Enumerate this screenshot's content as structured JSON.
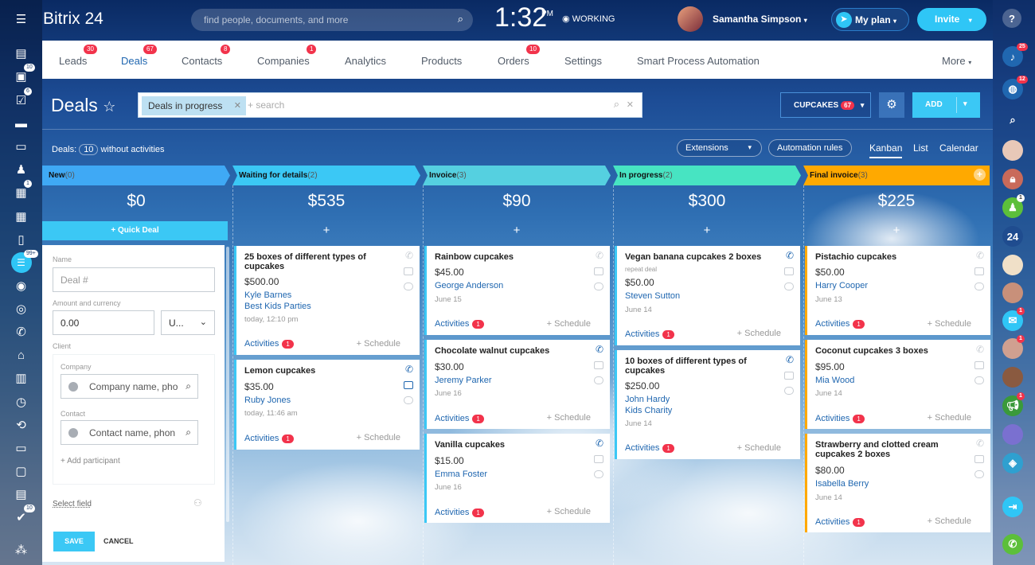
{
  "app": {
    "name": "Bitrix 24"
  },
  "search": {
    "placeholder": "find people, documents, and more"
  },
  "clock": {
    "time": "1:32",
    "ampm": "PM",
    "status": "WORKING"
  },
  "user": {
    "name": "Samantha Simpson"
  },
  "buttons": {
    "my_plan": "My plan",
    "invite": "Invite"
  },
  "nav": [
    {
      "label": "Leads",
      "badge": "30"
    },
    {
      "label": "Deals",
      "badge": "67"
    },
    {
      "label": "Contacts",
      "badge": "8"
    },
    {
      "label": "Companies",
      "badge": "1"
    },
    {
      "label": "Analytics"
    },
    {
      "label": "Products"
    },
    {
      "label": "Orders",
      "badge": "10"
    },
    {
      "label": "Settings"
    },
    {
      "label": "Smart Process Automation"
    },
    {
      "label": "More"
    }
  ],
  "page": {
    "title": "Deals"
  },
  "filter": {
    "tag": "Deals in progress",
    "search_placeholder": "+ search"
  },
  "toolbar": {
    "category": "CUPCAKES",
    "category_count": "67",
    "add": "ADD"
  },
  "info": {
    "prefix": "Deals:",
    "count": "10",
    "suffix": "without activities"
  },
  "controls": {
    "extensions": "Extensions",
    "automation": "Automation rules"
  },
  "views": {
    "kanban": "Kanban",
    "list": "List",
    "calendar": "Calendar"
  },
  "colors": {
    "accent": "#3bc8f5",
    "link": "#2067b0",
    "badge": "#f2334b"
  },
  "columns": [
    {
      "name": "New",
      "count": "(0)",
      "sum": "$0",
      "color": "#3fa9f5"
    },
    {
      "name": "Waiting for details",
      "count": "(2)",
      "sum": "$535",
      "color": "#3bc8f5"
    },
    {
      "name": "Invoice",
      "count": "(3)",
      "sum": "$90",
      "color": "#55d0e0"
    },
    {
      "name": "In progress",
      "count": "(2)",
      "sum": "$300",
      "color": "#47e4c2"
    },
    {
      "name": "Final invoice",
      "count": "(3)",
      "sum": "$225",
      "color": "#ffa900"
    }
  ],
  "quick_deal": "+ Quick Deal",
  "plus": "+",
  "form": {
    "name_label": "Name",
    "name_placeholder": "Deal #",
    "amount_label": "Amount and currency",
    "amount_value": "0.00",
    "currency_value": "U...",
    "client_label": "Client",
    "company_label": "Company",
    "company_placeholder": "Company name, pho",
    "contact_label": "Contact",
    "contact_placeholder": "Contact name, phon",
    "add_participant": "+ Add participant",
    "select_field": "Select field",
    "save": "SAVE",
    "cancel": "CANCEL"
  },
  "card_common": {
    "activities": "Activities",
    "schedule": "+ Schedule",
    "activity_count": "1"
  },
  "cards": {
    "c1": {
      "title": "25 boxes of different types of cupcakes",
      "price": "$500.00",
      "link1": "Kyle Barnes",
      "link2": "Best Kids Parties",
      "date": "today, 12:10 pm"
    },
    "c2": {
      "title": "Lemon cupcakes",
      "price": "$35.00",
      "link1": "Ruby Jones",
      "date": "today, 11:46 am"
    },
    "c3": {
      "title": "Rainbow cupcakes",
      "price": "$45.00",
      "link1": "George Anderson",
      "date": "June 15"
    },
    "c4": {
      "title": "Chocolate walnut cupcakes",
      "price": "$30.00",
      "link1": "Jeremy Parker",
      "date": "June 16"
    },
    "c5": {
      "title": "Vanilla cupcakes",
      "price": "$15.00",
      "link1": "Emma Foster",
      "date": "June 16"
    },
    "c6": {
      "title": "Vegan banana cupcakes 2 boxes",
      "note": "repeat deal",
      "price": "$50.00",
      "link1": "Steven Sutton",
      "date": "June 14"
    },
    "c7": {
      "title": "10 boxes of different types of cupcakes",
      "price": "$250.00",
      "link1": "John Hardy",
      "link2": "Kids Charity",
      "date": "June 14"
    },
    "c8": {
      "title": "Pistachio cupcakes",
      "price": "$50.00",
      "link1": "Harry Cooper",
      "date": "June 13"
    },
    "c9": {
      "title": "Coconut cupcakes 3 boxes",
      "price": "$95.00",
      "link1": "Mia Wood",
      "date": "June 14"
    },
    "c10": {
      "title": "Strawberry and clotted cream cupcakes 2 boxes",
      "price": "$80.00",
      "link1": "Isabella Berry",
      "date": "June 14"
    }
  },
  "left_badges": {
    "b1": "10",
    "b2": "6",
    "b3": "1",
    "b4": "99+",
    "b5": "10"
  },
  "right_badges": {
    "notify": "25",
    "chat": "12",
    "b1": "1",
    "b2": "1",
    "b3": "1",
    "b4": "1"
  },
  "right_items": {
    "badge24": "24"
  }
}
